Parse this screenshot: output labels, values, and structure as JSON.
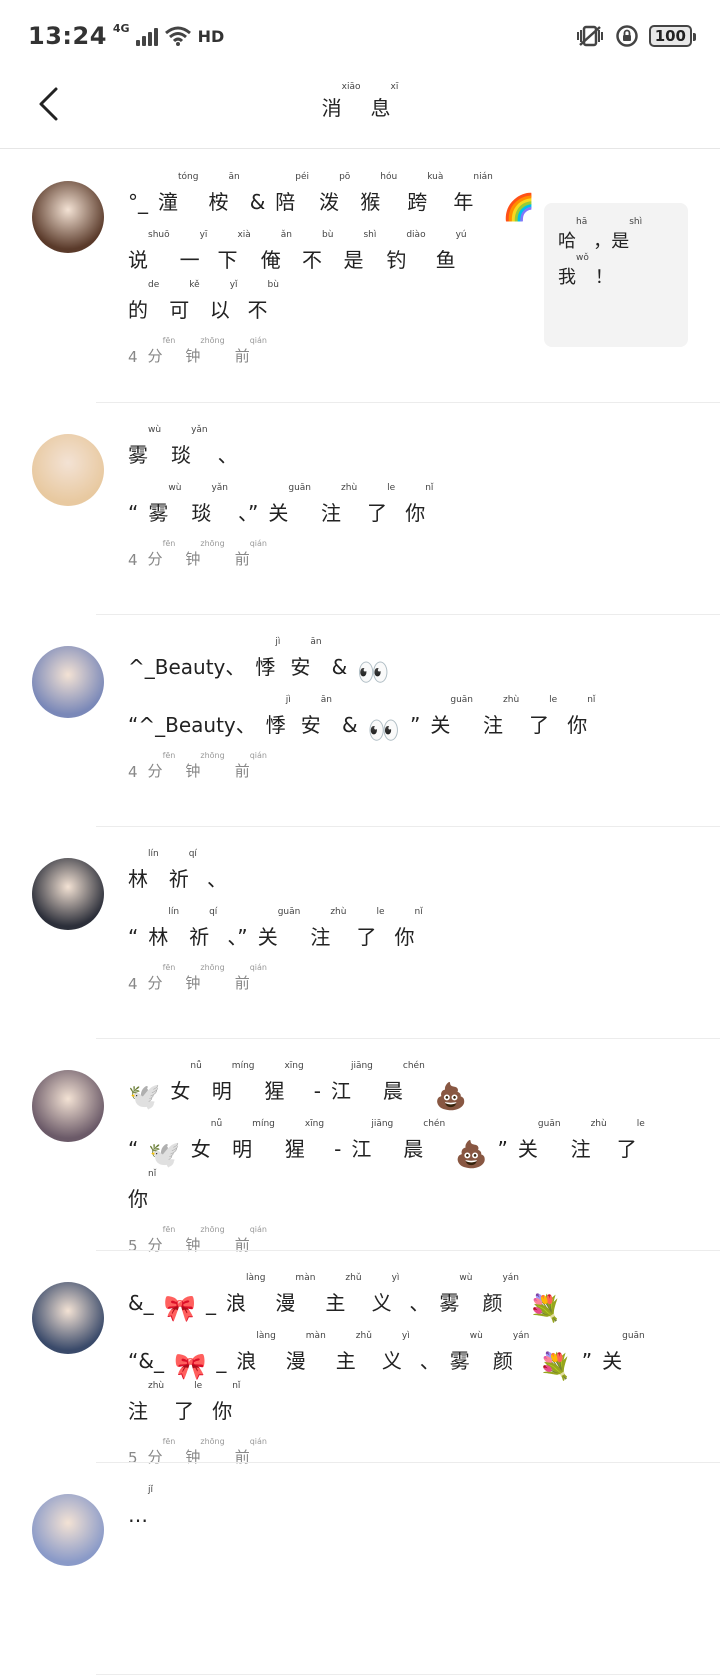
{
  "status_bar": {
    "time": "13:24",
    "network": "4G",
    "hd": "HD",
    "battery": "100"
  },
  "header": {
    "title_chars": [
      {
        "c": "消",
        "p": "xiāo"
      },
      {
        "c": "息",
        "p": "xī"
      }
    ]
  },
  "messages": [
    {
      "name": [
        {
          "c": "°_"
        },
        {
          "c": "潼",
          "p": "tóng"
        },
        {
          "c": "桉",
          "p": "ān"
        },
        {
          "c": "&"
        },
        {
          "c": "陪",
          "p": "péi"
        },
        {
          "c": "泼",
          "p": "pō"
        },
        {
          "c": "猴",
          "p": "hóu"
        },
        {
          "c": "跨",
          "p": "kuà"
        },
        {
          "c": "年",
          "p": "nián"
        },
        {
          "c": "🌈"
        }
      ],
      "text": [
        {
          "c": "说",
          "p": "shuō"
        },
        {
          "c": "一",
          "p": "yī"
        },
        {
          "c": "下",
          "p": "xià"
        },
        {
          "c": "俺",
          "p": "ǎn"
        },
        {
          "c": "不",
          "p": "bù"
        },
        {
          "c": "是",
          "p": "shì"
        },
        {
          "c": "钓",
          "p": "diào"
        },
        {
          "c": "鱼",
          "p": "yú"
        },
        {
          "c": "的",
          "p": "de"
        },
        {
          "c": "可",
          "p": "kě"
        },
        {
          "c": "以",
          "p": "yǐ"
        },
        {
          "c": "不",
          "p": "bù"
        }
      ],
      "time": [
        {
          "c": "4"
        },
        {
          "c": "分",
          "p": "fēn"
        },
        {
          "c": "钟",
          "p": "zhōng"
        },
        {
          "c": "前",
          "p": "qián"
        }
      ],
      "reply": [
        {
          "c": "哈",
          "p": "hā"
        },
        {
          "c": "，"
        },
        {
          "c": "是",
          "p": "shì"
        },
        {
          "c": "我",
          "p": "wǒ"
        },
        {
          "c": "！"
        }
      ],
      "avatar_color": "#5a3a2a"
    },
    {
      "name": [
        {
          "c": "雾",
          "p": "wù"
        },
        {
          "c": "琰",
          "p": "yǎn"
        },
        {
          "c": "、"
        }
      ],
      "text": [
        {
          "c": "“"
        },
        {
          "c": "雾",
          "p": "wù"
        },
        {
          "c": "琰",
          "p": "yǎn"
        },
        {
          "c": "、”"
        },
        {
          "c": "关",
          "p": "guān"
        },
        {
          "c": "注",
          "p": "zhù"
        },
        {
          "c": "了",
          "p": "le"
        },
        {
          "c": "你",
          "p": "nǐ"
        }
      ],
      "time": [
        {
          "c": "4"
        },
        {
          "c": "分",
          "p": "fēn"
        },
        {
          "c": "钟",
          "p": "zhōng"
        },
        {
          "c": "前",
          "p": "qián"
        }
      ],
      "avatar_color": "#e8c9a0"
    },
    {
      "name": [
        {
          "c": "^_Beauty、"
        },
        {
          "c": "悸",
          "p": "jì"
        },
        {
          "c": "安",
          "p": "ān"
        },
        {
          "c": "&"
        },
        {
          "c": "👀"
        }
      ],
      "text": [
        {
          "c": "“^_Beauty、"
        },
        {
          "c": "悸",
          "p": "jì"
        },
        {
          "c": "安",
          "p": "ān"
        },
        {
          "c": "&"
        },
        {
          "c": "👀"
        },
        {
          "c": "”"
        },
        {
          "c": "关",
          "p": "guān"
        },
        {
          "c": "注",
          "p": "zhù"
        },
        {
          "c": "了",
          "p": "le"
        },
        {
          "c": "你",
          "p": "nǐ"
        }
      ],
      "time": [
        {
          "c": "4"
        },
        {
          "c": "分",
          "p": "fēn"
        },
        {
          "c": "钟",
          "p": "zhōng"
        },
        {
          "c": "前",
          "p": "qián"
        }
      ],
      "avatar_color": "#7a88b8"
    },
    {
      "name": [
        {
          "c": "林",
          "p": "lín"
        },
        {
          "c": "祈",
          "p": "qí"
        },
        {
          "c": "、"
        }
      ],
      "text": [
        {
          "c": "“"
        },
        {
          "c": "林",
          "p": "lín"
        },
        {
          "c": "祈",
          "p": "qí"
        },
        {
          "c": "、”"
        },
        {
          "c": "关",
          "p": "guān"
        },
        {
          "c": "注",
          "p": "zhù"
        },
        {
          "c": "了",
          "p": "le"
        },
        {
          "c": "你",
          "p": "nǐ"
        }
      ],
      "time": [
        {
          "c": "4"
        },
        {
          "c": "分",
          "p": "fēn"
        },
        {
          "c": "钟",
          "p": "zhōng"
        },
        {
          "c": "前",
          "p": "qián"
        }
      ],
      "avatar_color": "#2c2f3a"
    },
    {
      "name": [
        {
          "c": "🕊️"
        },
        {
          "c": "女",
          "p": "nǚ"
        },
        {
          "c": "明",
          "p": "míng"
        },
        {
          "c": "猩",
          "p": "xīng"
        },
        {
          "c": "-"
        },
        {
          "c": "江",
          "p": "jiāng"
        },
        {
          "c": "晨",
          "p": "chén"
        },
        {
          "c": "💩"
        }
      ],
      "text": [
        {
          "c": "“"
        },
        {
          "c": "🕊️"
        },
        {
          "c": "女",
          "p": "nǚ"
        },
        {
          "c": "明",
          "p": "míng"
        },
        {
          "c": "猩",
          "p": "xīng"
        },
        {
          "c": "-"
        },
        {
          "c": "江",
          "p": "jiāng"
        },
        {
          "c": "晨",
          "p": "chén"
        },
        {
          "c": "💩"
        },
        {
          "c": "”"
        },
        {
          "c": "关",
          "p": "guān"
        },
        {
          "c": "注",
          "p": "zhù"
        },
        {
          "c": "了",
          "p": "le"
        },
        {
          "c": "你",
          "p": "nǐ"
        }
      ],
      "time": [
        {
          "c": "5"
        },
        {
          "c": "分",
          "p": "fēn"
        },
        {
          "c": "钟",
          "p": "zhōng"
        },
        {
          "c": "前",
          "p": "qián"
        }
      ],
      "avatar_color": "#6b5a68"
    },
    {
      "name": [
        {
          "c": "&_"
        },
        {
          "c": "🎀"
        },
        {
          "c": "_"
        },
        {
          "c": "浪",
          "p": "làng"
        },
        {
          "c": "漫",
          "p": "màn"
        },
        {
          "c": "主",
          "p": "zhǔ"
        },
        {
          "c": "义",
          "p": "yì"
        },
        {
          "c": "、"
        },
        {
          "c": "雾",
          "p": "wù"
        },
        {
          "c": "颜",
          "p": "yán"
        },
        {
          "c": "💐"
        }
      ],
      "text": [
        {
          "c": "“&_"
        },
        {
          "c": "🎀"
        },
        {
          "c": "_"
        },
        {
          "c": "浪",
          "p": "làng"
        },
        {
          "c": "漫",
          "p": "màn"
        },
        {
          "c": "主",
          "p": "zhǔ"
        },
        {
          "c": "义",
          "p": "yì"
        },
        {
          "c": "、"
        },
        {
          "c": "雾",
          "p": "wù"
        },
        {
          "c": "颜",
          "p": "yán"
        },
        {
          "c": "💐"
        },
        {
          "c": "”"
        },
        {
          "c": "关",
          "p": "guān"
        },
        {
          "c": "注",
          "p": "zhù"
        },
        {
          "c": "了",
          "p": "le"
        },
        {
          "c": "你",
          "p": "nǐ"
        }
      ],
      "time": [
        {
          "c": "5"
        },
        {
          "c": "分",
          "p": "fēn"
        },
        {
          "c": "钟",
          "p": "zhōng"
        },
        {
          "c": "前",
          "p": "qián"
        }
      ],
      "avatar_color": "#3a4a6a"
    },
    {
      "name": [
        {
          "c": "…",
          "p": "jǐ"
        }
      ],
      "text": [],
      "time": [],
      "avatar_color": "#8a9ac8"
    }
  ]
}
